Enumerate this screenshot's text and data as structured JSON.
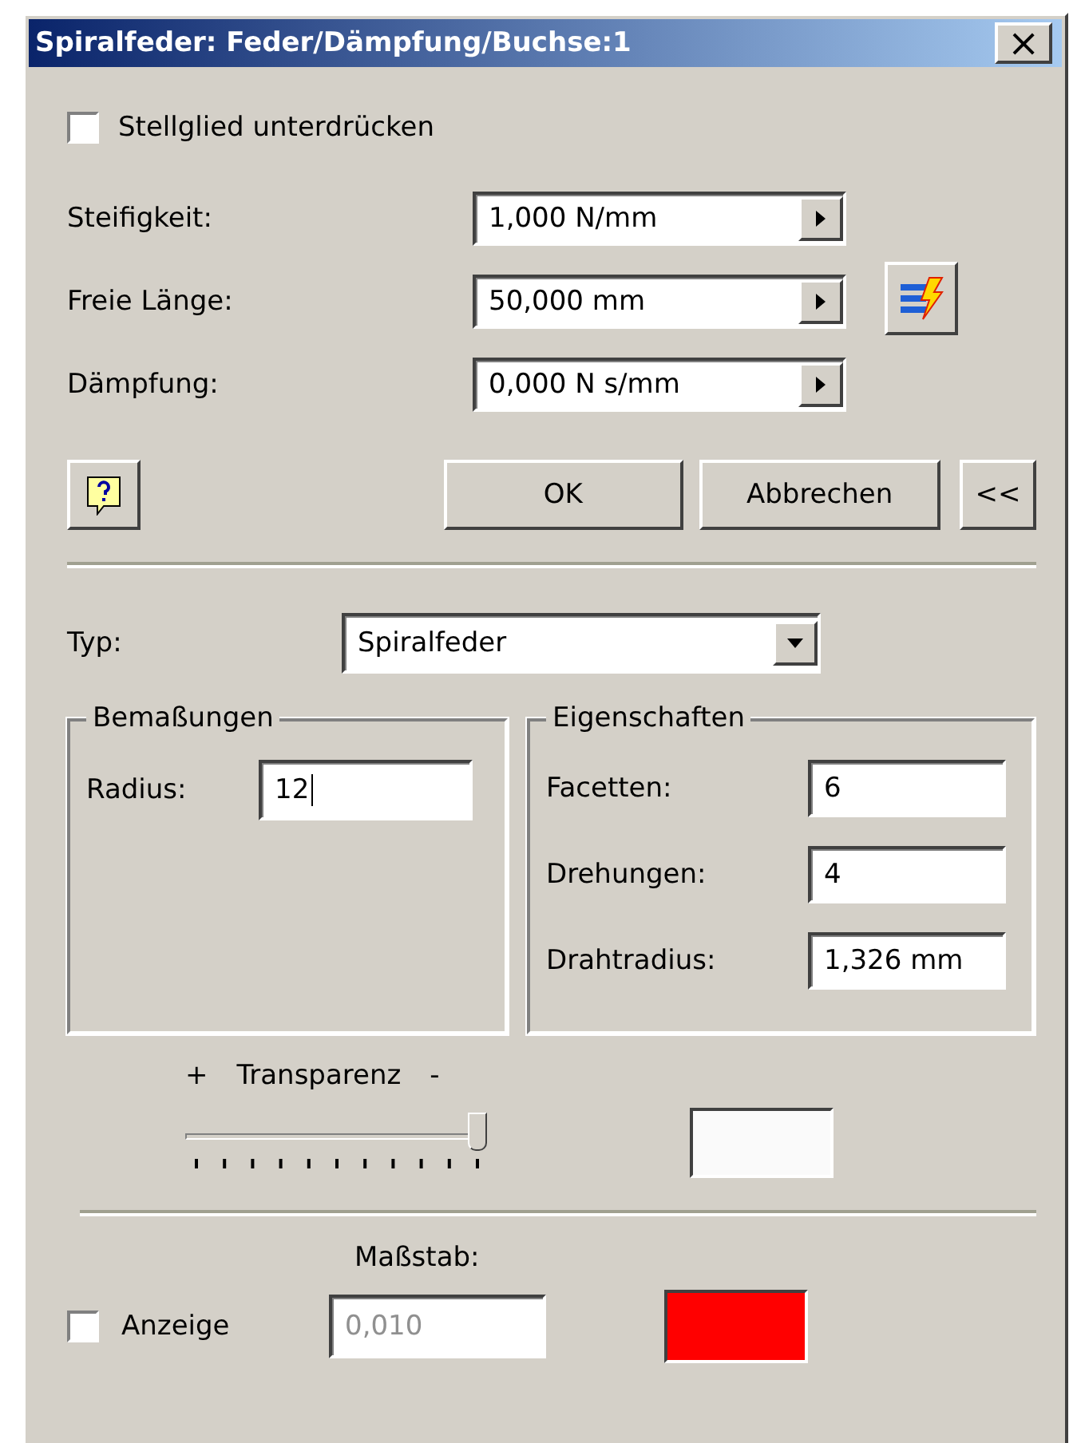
{
  "window": {
    "title": "Spiralfeder: Feder/Dämpfung/Buchse:1",
    "close": "×"
  },
  "suppress": {
    "label": "Stellglied unterdrücken",
    "checked": false
  },
  "params": [
    {
      "label": "Steifigkeit:",
      "value": "1,000 N/mm",
      "tool": false
    },
    {
      "label": "Freie Länge:",
      "value": "50,000 mm",
      "tool": true
    },
    {
      "label": "Dämpfung:",
      "value": "0,000 N s/mm",
      "tool": false
    }
  ],
  "buttons": {
    "ok": "OK",
    "cancel": "Abbrechen",
    "collapse": "<<"
  },
  "type": {
    "label": "Typ:",
    "value": "Spiralfeder"
  },
  "dimensions": {
    "title": "Bemaßungen",
    "fields": [
      {
        "label": "Radius:",
        "value": "12",
        "focused": true
      }
    ]
  },
  "properties": {
    "title": "Eigenschaften",
    "fields": [
      {
        "label": "Facetten:",
        "value": "6"
      },
      {
        "label": "Drehungen:",
        "value": "4"
      },
      {
        "label": "Drahtradius:",
        "value": "1,326 mm"
      }
    ]
  },
  "transparency": {
    "plus": "+",
    "label": "Transparenz",
    "minus": "-",
    "level": 1,
    "color": "#fafafa"
  },
  "scale": {
    "label": "Maßstab:",
    "show_label": "Anzeige",
    "checked": false,
    "value": "0,010",
    "disabled": true,
    "color": "#ff0000"
  }
}
